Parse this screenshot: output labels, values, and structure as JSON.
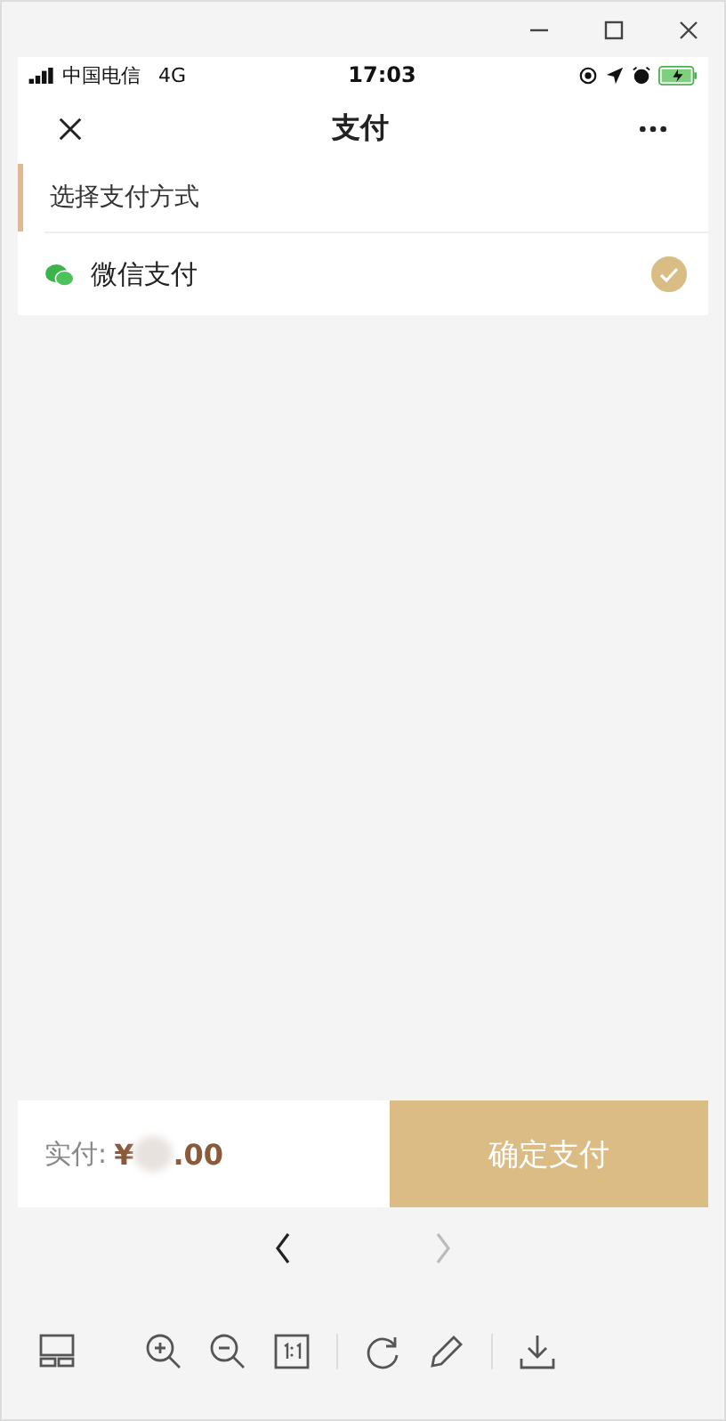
{
  "status_bar": {
    "carrier": "中国电信",
    "network": "4G",
    "time": "17:03"
  },
  "nav": {
    "title": "支付"
  },
  "section": {
    "title": "选择支付方式"
  },
  "payment_methods": [
    {
      "name": "微信支付",
      "selected": true
    }
  ],
  "footer": {
    "label": "实付:",
    "currency": "¥",
    "amount_tail": ".00",
    "amount_redacted": true,
    "button": "确定支付"
  },
  "viewer": {
    "prev_enabled": true,
    "next_enabled": false
  }
}
